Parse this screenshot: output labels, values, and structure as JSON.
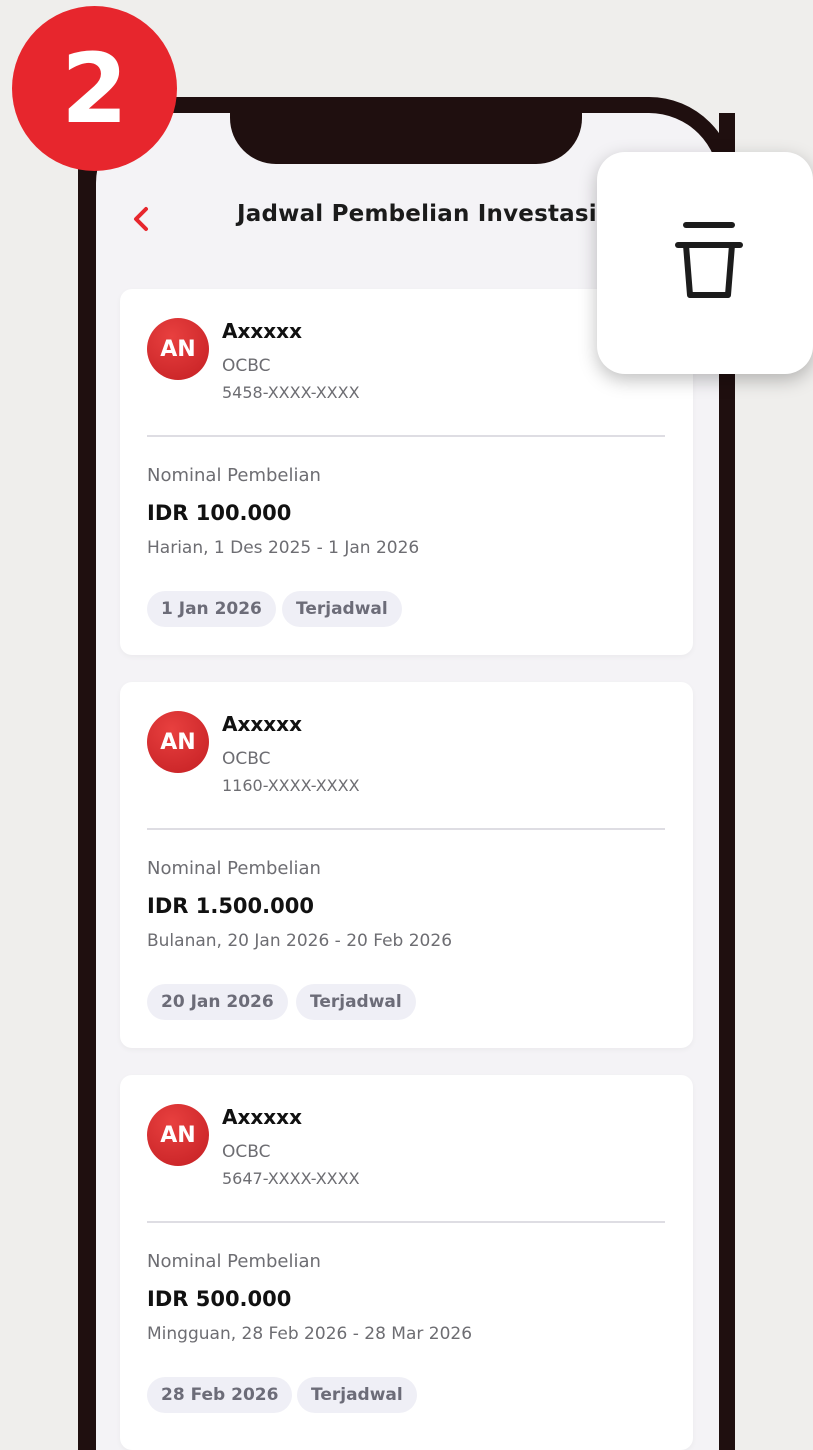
{
  "step_badge": "2",
  "header": {
    "title": "Jadwal Pembelian Investasi",
    "back_icon": "chevron-left-icon"
  },
  "delete_action": {
    "icon": "trash-icon"
  },
  "colors": {
    "brand": "#e7262d",
    "chip_bg": "#efeff6",
    "screen_bg": "#f4f3f6"
  },
  "schedules": [
    {
      "avatar_initials": "AN",
      "name": "Axxxxx",
      "bank": "OCBC",
      "account": "5458-XXXX-XXXX",
      "nominal_label": "Nominal Pembelian",
      "amount": "IDR 100.000",
      "period": "Harian, 1 Des 2025 - 1 Jan 2026",
      "next_date": "1 Jan 2026",
      "status": "Terjadwal"
    },
    {
      "avatar_initials": "AN",
      "name": "Axxxxx",
      "bank": "OCBC",
      "account": "1160-XXXX-XXXX",
      "nominal_label": "Nominal Pembelian",
      "amount": "IDR 1.500.000",
      "period": "Bulanan, 20 Jan 2026 - 20 Feb 2026",
      "next_date": "20 Jan 2026",
      "status": "Terjadwal"
    },
    {
      "avatar_initials": "AN",
      "name": "Axxxxx",
      "bank": "OCBC",
      "account": "5647-XXXX-XXXX",
      "nominal_label": "Nominal Pembelian",
      "amount": "IDR 500.000",
      "period": "Mingguan, 28 Feb 2026 - 28 Mar 2026",
      "next_date": "28 Feb 2026",
      "status": "Terjadwal"
    }
  ]
}
